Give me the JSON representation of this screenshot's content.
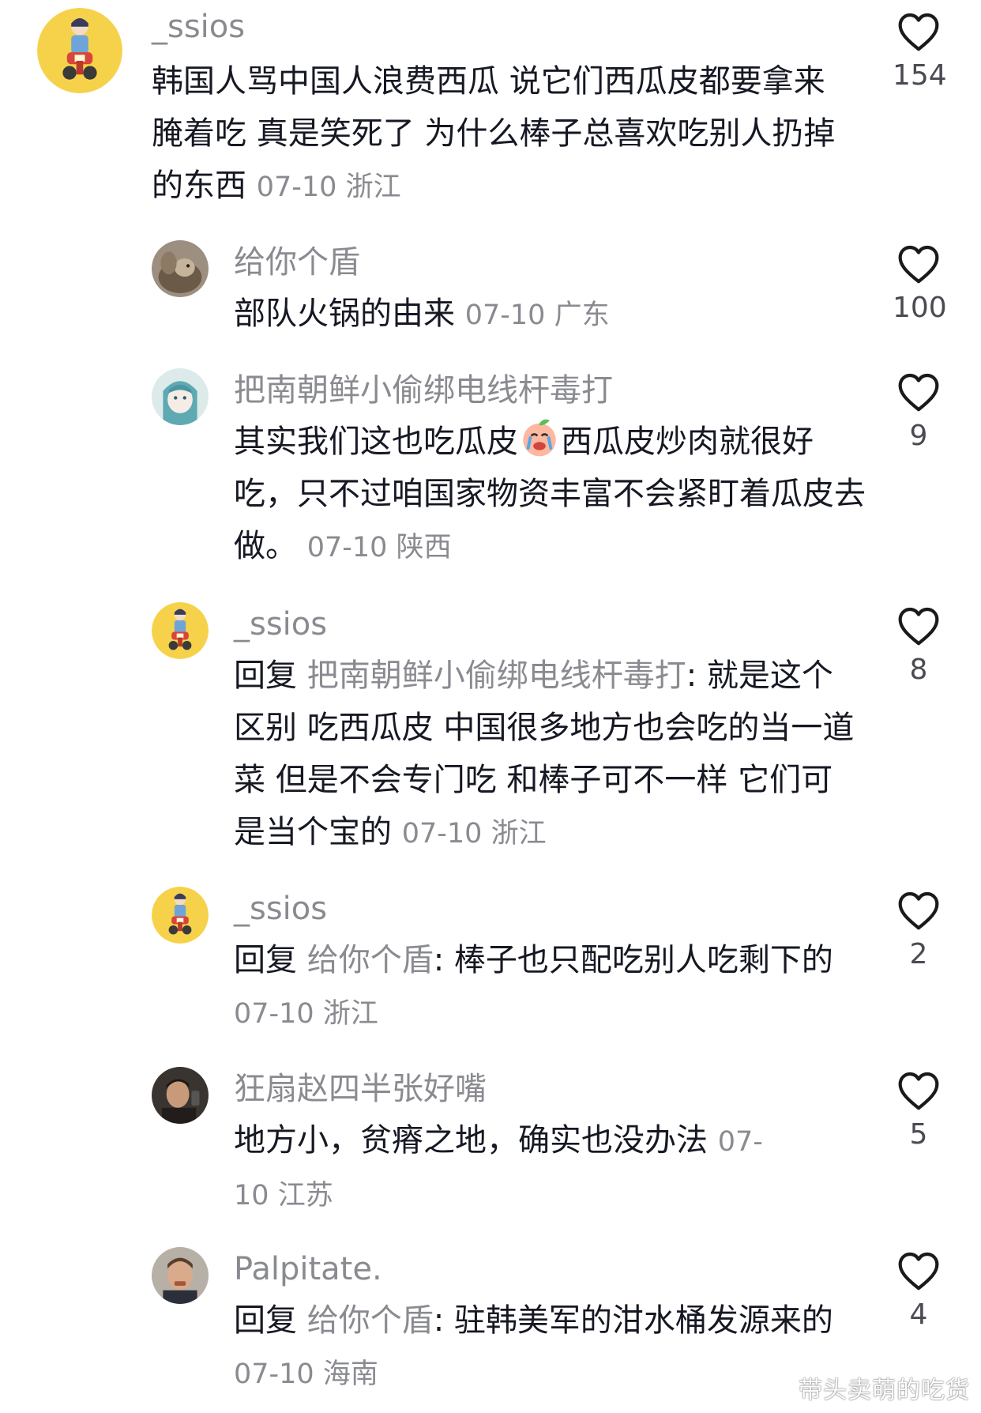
{
  "colors": {
    "text_primary": "#161823",
    "text_secondary": "#8a8b91",
    "like_heart": "#1a1a1a"
  },
  "comments": [
    {
      "username": "_ssios",
      "text": "韩国人骂中国人浪费西瓜 说它们西瓜皮都要拿来腌着吃 真是笑死了 为什么棒子总喜欢吃别人扔掉的东西",
      "date": "07-10",
      "region": "浙江",
      "likes": "154",
      "avatar": "cartoon-scooter-avatar"
    },
    {
      "username": "给你个盾",
      "text": "部队火锅的由来",
      "date": "07-10",
      "region": "广东",
      "likes": "100",
      "avatar": "squirrel-photo-avatar"
    },
    {
      "username": "把南朝鲜小偷绑电线杆毒打",
      "text_before_emoji": "其实我们这也吃瓜皮",
      "emoji": "crying-peach-emoji",
      "text_after_emoji": "西瓜皮炒肉就很好吃，只不过咱国家物资丰富不会紧盯着瓜皮去做。",
      "date": "07-10",
      "region": "陕西",
      "likes": "9",
      "avatar": "anime-girl-avatar"
    },
    {
      "username": "_ssios",
      "reply_prefix": "回复",
      "reply_to": "把南朝鲜小偷绑电线杆毒打",
      "text": ": 就是这个区别 吃西瓜皮 中国很多地方也会吃的当一道菜 但是不会专门吃 和棒子可不一样 它们可是当个宝的",
      "date": "07-10",
      "region": "浙江",
      "likes": "8",
      "avatar": "cartoon-scooter-avatar"
    },
    {
      "username": "_ssios",
      "reply_prefix": "回复",
      "reply_to": "给你个盾",
      "text": ": 棒子也只配吃别人吃剩下的",
      "date": "07-10",
      "region": "浙江",
      "likes": "2",
      "avatar": "cartoon-scooter-avatar"
    },
    {
      "username": "狂扇赵四半张好嘴",
      "text": "地方小，贫瘠之地，确实也没办法",
      "date": "07-10",
      "region": "江苏",
      "likes": "5",
      "avatar": "man-photo-avatar"
    },
    {
      "username": "Palpitate.",
      "reply_prefix": "回复",
      "reply_to": "给你个盾",
      "text": ": 驻韩美军的泔水桶发源来的",
      "date": "07-10",
      "region": "海南",
      "likes": "4",
      "avatar": "man-photo-avatar-2"
    }
  ],
  "watermark": "带头卖萌的吃货"
}
